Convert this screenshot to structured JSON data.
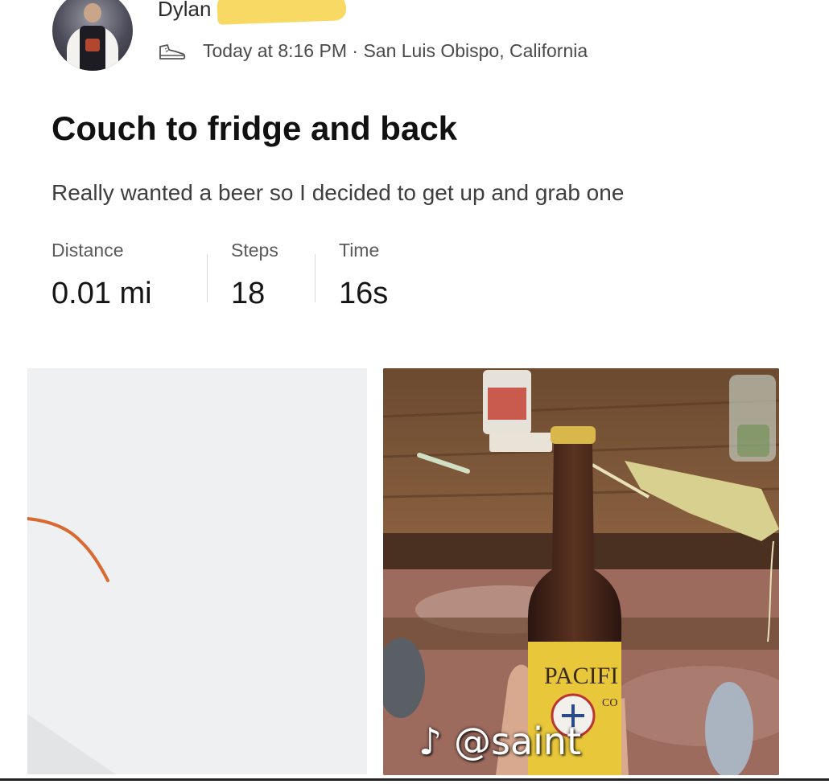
{
  "post": {
    "author": "Dylan",
    "timestamp": "Today at 8:16 PM",
    "separator": "·",
    "location": "San Luis Obispo, California",
    "title": "Couch to fridge and back",
    "description": "Really wanted a beer so I decided to get up and grab one"
  },
  "stats": [
    {
      "label": "Distance",
      "value": "0.01 mi"
    },
    {
      "label": "Steps",
      "value": "18"
    },
    {
      "label": "Time",
      "value": "16s"
    }
  ],
  "icons": {
    "activity": "shoe-icon",
    "watermark": "tiktok-icon"
  },
  "photo": {
    "bottle_label": "PACIFI",
    "bottle_label_sub": "CO"
  },
  "watermark": {
    "symbol": "♪",
    "handle": "@saint"
  },
  "colors": {
    "route": "#d9692f",
    "redaction": "#f7d75c",
    "map_bg": "#eef0f1"
  }
}
